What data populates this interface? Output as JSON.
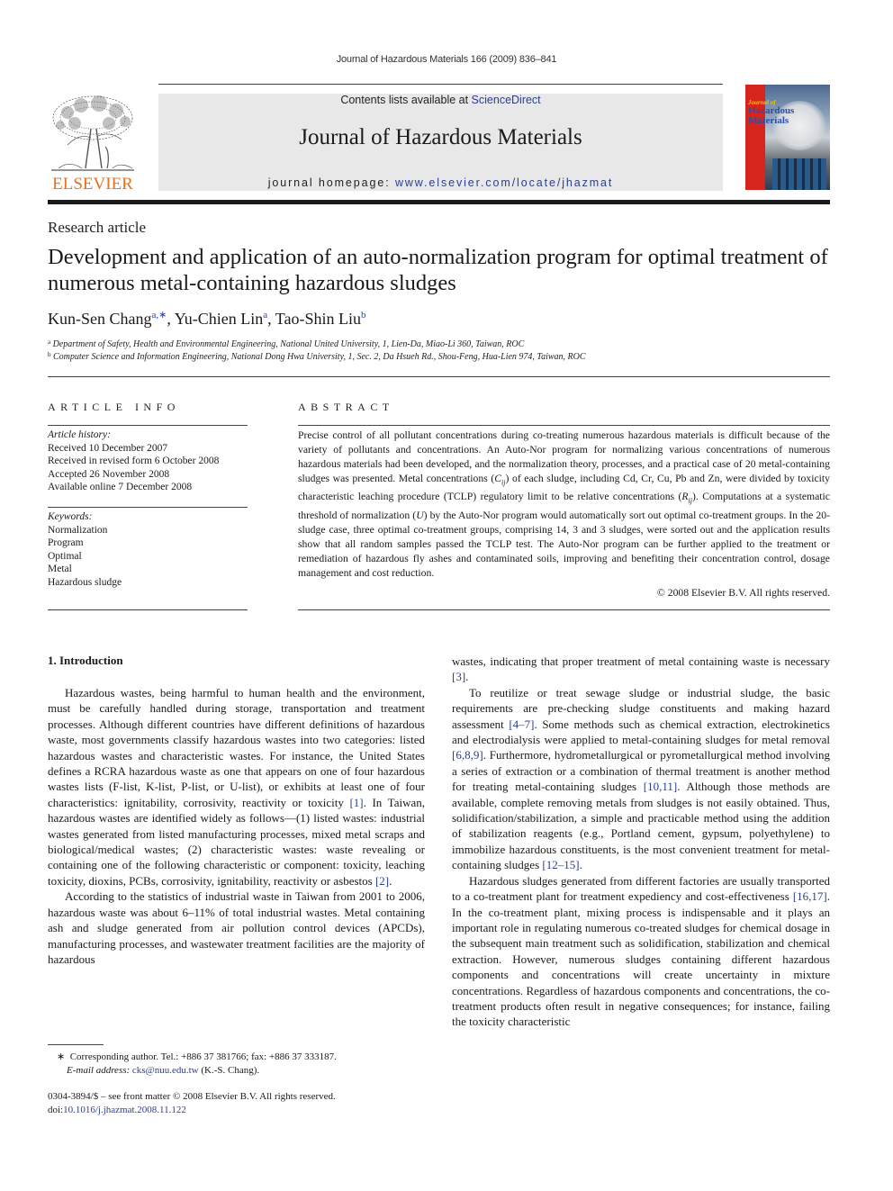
{
  "running_head": "Journal of Hazardous Materials 166 (2009) 836–841",
  "banner": {
    "contents_prefix": "Contents lists available at ",
    "contents_link": "ScienceDirect",
    "journal_name": "Journal of Hazardous Materials",
    "homepage_prefix": "journal homepage: ",
    "homepage_url": "www.elsevier.com/locate/jhazmat"
  },
  "publisher_logo_text": "ELSEVIER",
  "cover": {
    "small_label": "Journal of",
    "title_line1": "Hazardous",
    "title_line2": "Materials"
  },
  "colors": {
    "link": "#2a3f8f",
    "elsevier_orange": "#e9711c",
    "banner_gray": "#e8e8e8",
    "cover_red": "#d7251e"
  },
  "article_type": "Research article",
  "title": "Development and application of an auto-normalization program for optimal treatment of numerous metal-containing hazardous sludges",
  "authors": [
    {
      "name": "Kun-Sen Chang",
      "sup": "a,∗"
    },
    {
      "name": "Yu-Chien Lin",
      "sup": "a"
    },
    {
      "name": "Tao-Shin Liu",
      "sup": "b"
    }
  ],
  "affiliations": [
    {
      "mark": "a",
      "text": "Department of Safety, Health and Environmental Engineering, National United University, 1, Lien-Da, Miao-Li 360, Taiwan, ROC"
    },
    {
      "mark": "b",
      "text": "Computer Science and Information Engineering, National Dong Hwa University, 1, Sec. 2, Da Hsueh Rd., Shou-Feng, Hua-Lien 974, Taiwan, ROC"
    }
  ],
  "article_info": {
    "heading": "ARTICLE INFO",
    "history_label": "Article history:",
    "history": [
      "Received 10 December 2007",
      "Received in revised form 6 October 2008",
      "Accepted 26 November 2008",
      "Available online 7 December 2008"
    ],
    "keywords_label": "Keywords:",
    "keywords": [
      "Normalization",
      "Program",
      "Optimal",
      "Metal",
      "Hazardous sludge"
    ]
  },
  "abstract": {
    "heading": "ABSTRACT",
    "part1": "Precise control of all pollutant concentrations during co-treating numerous hazardous materials is difficult because of the variety of pollutants and concentrations. An Auto-Nor program for normalizing various concentrations of numerous hazardous materials had been developed, and the normalization theory, processes, and a practical case of 20 metal-containing sludges was presented. Metal concentrations (",
    "c_var": "C",
    "c_sub": "ij",
    "part2": ") of each sludge, including Cd, Cr, Cu, Pb and Zn, were divided by toxicity characteristic leaching procedure (TCLP) regulatory limit to be relative concentrations (",
    "r_var": "R",
    "r_sub": "ij",
    "part3": "). Computations at a systematic threshold of normalization (",
    "u_var": "U",
    "part4": ") by the Auto-Nor program would automatically sort out optimal co-treatment groups. In the 20-sludge case, three optimal co-treatment groups, comprising 14, 3 and 3 sludges, were sorted out and the application results show that all random samples passed the TCLP test. The Auto-Nor program can be further applied to the treatment or remediation of hazardous fly ashes and contaminated soils, improving and benefiting their concentration control, dosage management and cost reduction.",
    "copyright": "© 2008 Elsevier B.V. All rights reserved."
  },
  "intro": {
    "heading": "1.  Introduction",
    "left": {
      "p1_a": "Hazardous wastes, being harmful to human health and the environment, must be carefully handled during storage, transportation and treatment processes. Although different countries have different definitions of hazardous waste, most governments classify hazardous wastes into two categories: listed hazardous wastes and characteristic wastes. For instance, the United States defines a RCRA hazardous waste as one that appears on one of four hazardous wastes lists (F-list, K-list, P-list, or U-list), or exhibits at least one of four characteristics: ignitability, corrosivity, reactivity or toxicity ",
      "p1_ref1": "[1]",
      "p1_b": ". In Taiwan, hazardous wastes are identified widely as follows—(1) listed wastes: industrial wastes generated from listed manufacturing processes, mixed metal scraps and biological/medical wastes; (2) characteristic wastes: waste revealing or containing one of the following characteristic or component: toxicity, leaching toxicity, dioxins, PCBs, corrosivity, ignitability, reactivity or asbestos ",
      "p1_ref2": "[2]",
      "p1_c": ".",
      "p2": "According to the statistics of industrial waste in Taiwan from 2001 to 2006, hazardous waste was about 6–11% of total industrial wastes. Metal containing ash and sludge generated from air pollution control devices (APCDs), manufacturing processes, and wastewater treatment facilities are the majority of hazardous"
    },
    "right": {
      "p0_a": "wastes, indicating that proper treatment of metal containing waste is necessary ",
      "p0_ref": "[3]",
      "p0_b": ".",
      "p1_a": "To reutilize or treat sewage sludge or industrial sludge, the basic requirements are pre-checking sludge constituents and making hazard assessment ",
      "p1_ref1": "[4–7]",
      "p1_b": ". Some methods such as chemical extraction, electrokinetics and electrodialysis were applied to metal-containing sludges for metal removal ",
      "p1_ref2": "[6,8,9]",
      "p1_c": ". Furthermore, hydrometallurgical or pyrometallurgical method involving a series of extraction or a combination of thermal treatment is another method for treating metal-containing sludges ",
      "p1_ref3": "[10,11]",
      "p1_d": ". Although those methods are available, complete removing metals from sludges is not easily obtained. Thus, solidification/stabilization, a simple and practicable method using the addition of stabilization reagents (e.g., Portland cement, gypsum, polyethylene) to immobilize hazardous constituents, is the most convenient treatment for metal-containing sludges ",
      "p1_ref4": "[12–15]",
      "p1_e": ".",
      "p2_a": "Hazardous sludges generated from different factories are usually transported to a co-treatment plant for treatment expediency and cost-effectiveness ",
      "p2_ref": "[16,17]",
      "p2_b": ". In the co-treatment plant, mixing process is indispensable and it plays an important role in regulating numerous co-treated sludges for chemical dosage in the subsequent main treatment such as solidification, stabilization and chemical extraction. However, numerous sludges containing different hazardous components and concentrations will create uncertainty in mixture concentrations. Regardless of hazardous components and concentrations, the co-treatment products often result in negative consequences; for instance, failing the toxicity characteristic"
    }
  },
  "footnotes": {
    "star": "∗",
    "corresponding": "Corresponding author. Tel.: +886 37 381766; fax: +886 37 333187.",
    "email_label": "E-mail address: ",
    "email": "cks@nuu.edu.tw",
    "email_suffix": " (K.-S. Chang).",
    "front_matter": "0304-3894/$ – see front matter © 2008 Elsevier B.V. All rights reserved.",
    "doi_prefix": "doi:",
    "doi": "10.1016/j.jhazmat.2008.11.122"
  }
}
